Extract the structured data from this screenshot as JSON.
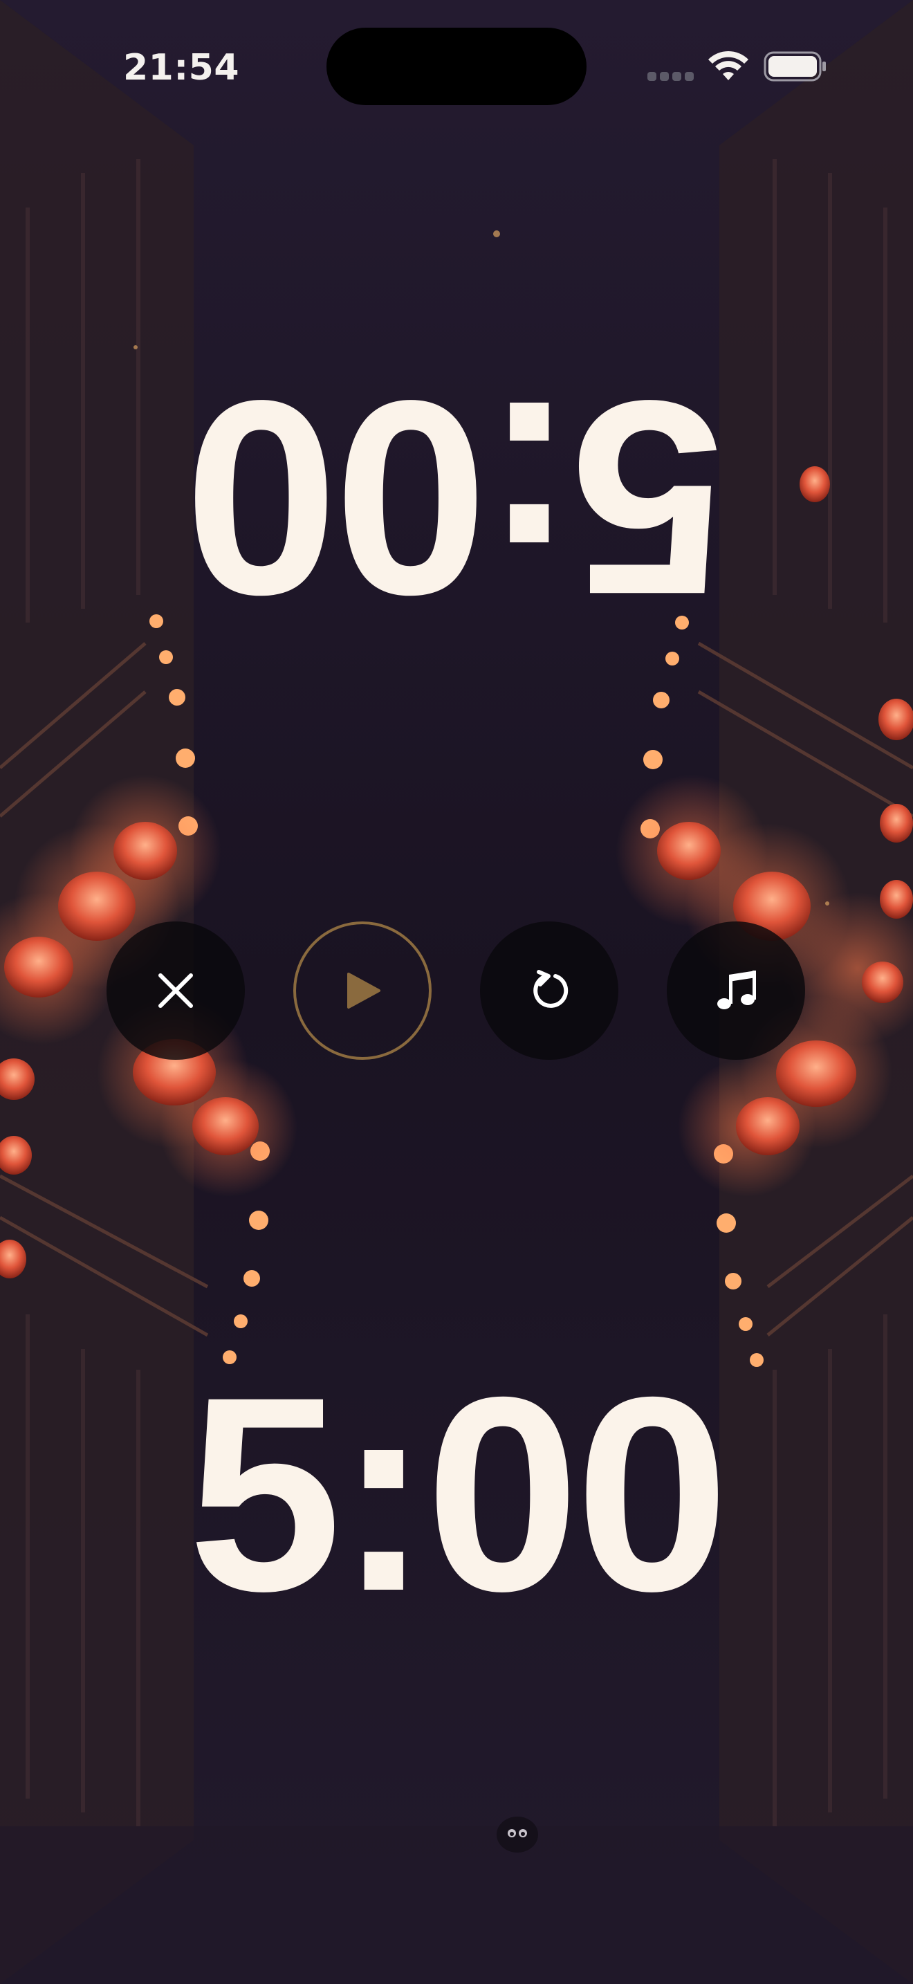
{
  "status_bar": {
    "time": "21:54",
    "icons": [
      "cellular-signal-icon",
      "wifi-icon",
      "battery-icon"
    ]
  },
  "timers": {
    "opponent_time": "5:00",
    "player_time": "5:00"
  },
  "controls": [
    {
      "name": "close-button",
      "icon": "close-icon"
    },
    {
      "name": "play-button",
      "icon": "play-icon"
    },
    {
      "name": "reset-button",
      "icon": "reset-icon"
    },
    {
      "name": "music-button",
      "icon": "music-note-icon"
    }
  ],
  "colors": {
    "background": "#1a1322",
    "timer_text": "#fbf3ea",
    "play_accent": "#8a6a3e",
    "lantern": "#e0553a",
    "button_fill": "#0a080c"
  }
}
